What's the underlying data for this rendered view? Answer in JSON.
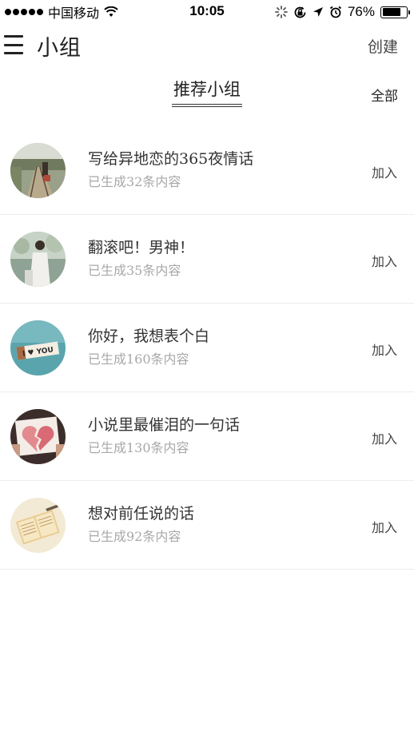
{
  "status_bar": {
    "carrier": "中国移动",
    "time": "10:05",
    "battery_percent": "76%",
    "battery_level": 0.76,
    "icons": [
      "signal-dots-icon",
      "wifi-icon",
      "activity-spinner-icon",
      "rotation-lock-icon",
      "location-arrow-icon",
      "alarm-icon",
      "battery-icon"
    ]
  },
  "nav": {
    "menu_icon": "menu-icon",
    "title": "小组",
    "create_label": "创建"
  },
  "section": {
    "title": "推荐小组",
    "all_label": "全部"
  },
  "groups": [
    {
      "name": "写给异地恋的365夜情话",
      "count": "已生成32条内容",
      "join_label": "加入",
      "avatar": "railway-photo"
    },
    {
      "name": "翻滚吧！男神！",
      "count": "已生成35条内容",
      "join_label": "加入",
      "avatar": "person-in-white-photo"
    },
    {
      "name": "你好，我想表个白",
      "count": "已生成160条内容",
      "join_label": "加入",
      "avatar": "i-love-you-sign-photo",
      "avatar_text": "I ♥ YOU"
    },
    {
      "name": "小说里最催泪的一句话",
      "count": "已生成130条内容",
      "join_label": "加入",
      "avatar": "broken-heart-photo"
    },
    {
      "name": "想对前任说的话",
      "count": "已生成92条内容",
      "join_label": "加入",
      "avatar": "open-notebook-photo"
    }
  ],
  "colors": {
    "background": "#ffffff",
    "text_primary": "#333333",
    "text_secondary": "#a8a8a8",
    "divider": "#ececec"
  }
}
